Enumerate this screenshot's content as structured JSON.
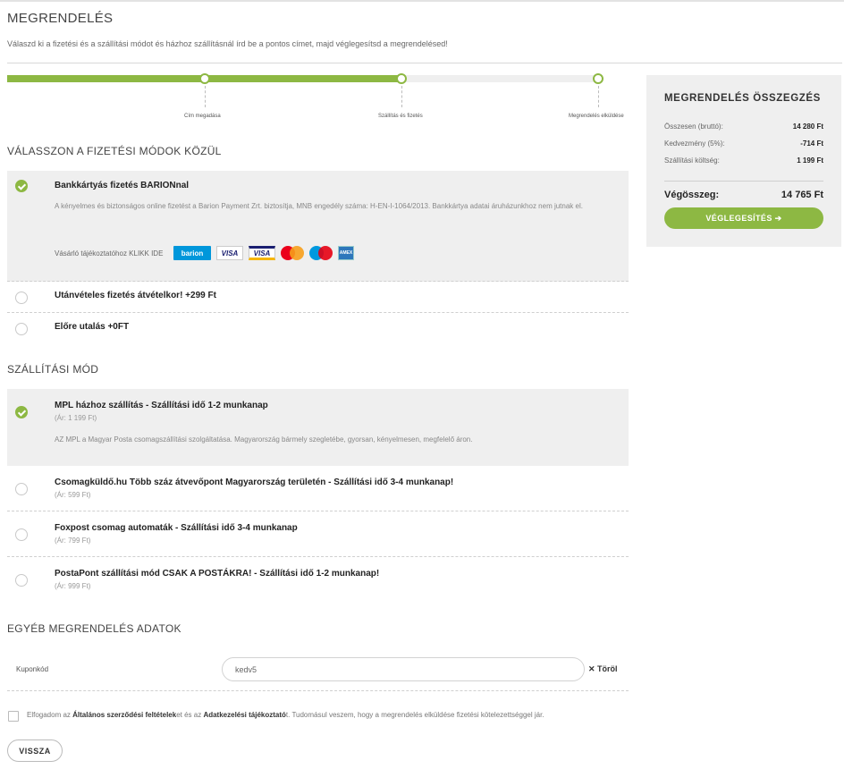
{
  "header": {
    "title": "MEGRENDELÉS",
    "subtitle": "Válaszd ki a fizetési és a szállítási módot és házhoz szállításnál írd be a pontos címet, majd véglegesítsd a megrendelésed!"
  },
  "progress": {
    "fraction": 0.67,
    "steps": [
      "Cím megadása",
      "Szállítás és fizetés",
      "Megrendelés elküldése"
    ]
  },
  "payment": {
    "section_title": "VÁLASSZON A FIZETÉSI MÓDOK KÖZÜL",
    "options": [
      {
        "title": "Bankkártyás fizetés BARIONnal",
        "desc": "A kényelmes és biztonságos online fizetést a Barion Payment Zrt. biztosítja, MNB engedély száma: H-EN-I-1064/2013. Bankkártya adatai áruházunkhoz nem jutnak el.",
        "info": "Vásárló tájékoztatóhoz KLIKK IDE",
        "selected": true
      },
      {
        "title": "Utánvételes fizetés átvételkor! +299 Ft",
        "selected": false
      },
      {
        "title": "Előre utalás +0FT",
        "selected": false
      }
    ],
    "logos": {
      "barion": "barion",
      "visa": "VISA",
      "visa_electron": "VISA",
      "amex": "AMEX"
    }
  },
  "shipping": {
    "section_title": "SZÁLLÍTÁSI MÓD",
    "options": [
      {
        "title": "MPL házhoz szállítás - Szállítási idő 1-2 munkanap",
        "price": "(Ár: 1 199 Ft)",
        "desc": "AZ MPL a Magyar Posta csomagszállítási szolgáltatása. Magyarország bármely szegletébe, gyorsan, kényelmesen, megfelelő áron.",
        "selected": true
      },
      {
        "title": "Csomagküldő.hu Több száz átvevőpont Magyarország területén - Szállítási idő 3-4 munkanap!",
        "price": "(Ár: 599 Ft)",
        "selected": false
      },
      {
        "title": "Foxpost csomag automaták - Szállítási idő 3-4 munkanap",
        "price": "(Ár: 799 Ft)",
        "selected": false
      },
      {
        "title": "PostaPont szállítási mód CSAK A POSTÁKRA! - Szállítási idő 1-2 munkanap!",
        "price": "(Ár: 999 Ft)",
        "selected": false
      }
    ]
  },
  "other": {
    "section_title": "EGYÉB MEGRENDELÉS ADATOK",
    "coupon_label": "Kuponkód",
    "coupon_value": "kedv5",
    "coupon_remove": "✕ Töröl"
  },
  "terms": {
    "t1": "Elfogadom az ",
    "l1": "Általános szerződési feltételek",
    "t2": "et és az ",
    "l2": "Adatkezelési tájékoztató",
    "t3": "t. Tudomásul veszem, hogy a megrendelés elküldése fizetési kötelezettséggel jár."
  },
  "back_label": "VISSZA",
  "summary": {
    "title": "MEGRENDELÉS ÖSSZEGZÉS",
    "rows": [
      {
        "label": "Összesen (bruttó):",
        "value": "14 280 Ft"
      },
      {
        "label": "Kedvezmény (5%):",
        "value": "-714 Ft"
      },
      {
        "label": "Szállítási költség:",
        "value": "1 199 Ft"
      }
    ],
    "total_label": "Végösszeg:",
    "total_value": "14 765 Ft",
    "finalize_label": "VÉGLEGESÍTÉS ➔"
  },
  "colors": {
    "accent": "#8db843",
    "panel": "#efefef"
  }
}
